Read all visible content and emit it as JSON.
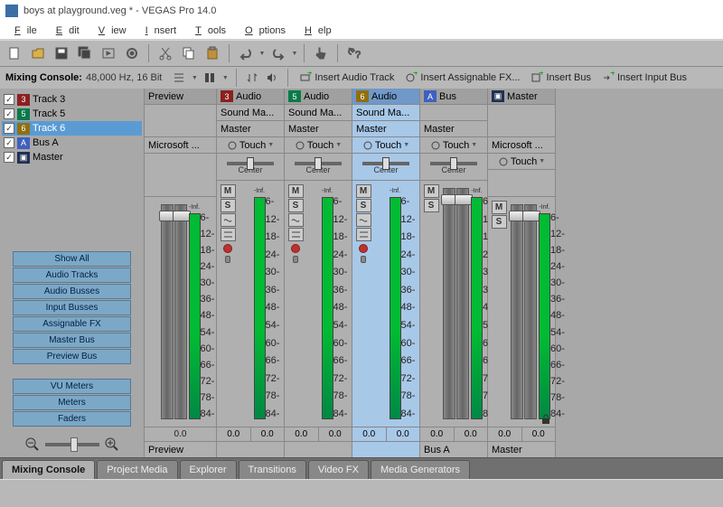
{
  "title": "boys at playground.veg * - VEGAS Pro 14.0",
  "menu": {
    "file": "File",
    "edit": "Edit",
    "view": "View",
    "insert": "Insert",
    "tools": "Tools",
    "options": "Options",
    "help": "Help"
  },
  "mixing": {
    "label": "Mixing Console:",
    "info": "48,000 Hz, 16 Bit"
  },
  "insert": {
    "audioTrack": "Insert Audio Track",
    "assignFx": "Insert Assignable FX...",
    "bus": "Insert Bus",
    "inputBus": "Insert Input Bus"
  },
  "tracks": [
    {
      "num": "3",
      "cls": "c3",
      "name": "Track 3",
      "sel": false
    },
    {
      "num": "5",
      "cls": "c5",
      "name": "Track 5",
      "sel": false
    },
    {
      "num": "6",
      "cls": "c6",
      "name": "Track 6",
      "sel": true
    },
    {
      "num": "A",
      "cls": "cA",
      "name": "Bus A",
      "sel": false
    },
    {
      "num": "",
      "cls": "cM",
      "name": "Master",
      "sel": false
    }
  ],
  "filters": {
    "showAll": "Show All",
    "audioTracks": "Audio Tracks",
    "audioBusses": "Audio Busses",
    "inputBusses": "Input Busses",
    "assignFx": "Assignable FX",
    "masterBus": "Master Bus",
    "previewBus": "Preview Bus",
    "vuMeters": "VU Meters",
    "meters": "Meters",
    "faders": "Faders"
  },
  "touch": "Touch",
  "center": "Center",
  "inf": "-Inf.",
  "scale": [
    "6-",
    "12-",
    "18-",
    "24-",
    "30-",
    "36-",
    "48-",
    "54-",
    "60-",
    "66-",
    "72-",
    "78-",
    "84-"
  ],
  "channels": {
    "preview": {
      "head": "Preview",
      "row1": "Microsoft ...",
      "foot": "Preview",
      "val": "0.0"
    },
    "a3": {
      "num": "3",
      "name": "Audio",
      "row1": "Sound Ma...",
      "row2": "Master",
      "foot": "",
      "v1": "0.0",
      "v2": "0.0"
    },
    "a5": {
      "num": "5",
      "name": "Audio",
      "row1": "Sound Ma...",
      "row2": "Master",
      "foot": "",
      "v1": "0.0",
      "v2": "0.0"
    },
    "a6": {
      "num": "6",
      "name": "Audio",
      "row1": "Sound Ma...",
      "row2": "Master",
      "foot": "",
      "v1": "0.0",
      "v2": "0.0"
    },
    "busA": {
      "num": "A",
      "name": "Bus",
      "row2": "Master",
      "foot": "Bus A",
      "v1": "0.0",
      "v2": "0.0"
    },
    "master": {
      "name": "Master",
      "row1": "Microsoft ...",
      "foot": "Master",
      "v1": "0.0",
      "v2": "0.0"
    }
  },
  "tabs": {
    "mixing": "Mixing Console",
    "project": "Project Media",
    "explorer": "Explorer",
    "transitions": "Transitions",
    "videofx": "Video FX",
    "media": "Media Generators"
  }
}
